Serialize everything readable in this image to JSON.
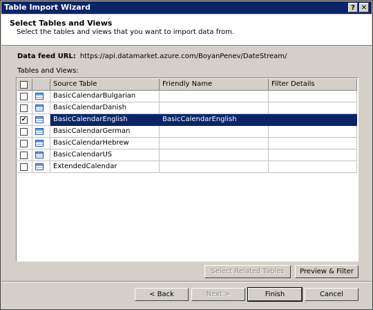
{
  "window": {
    "title": "Table Import Wizard",
    "help_glyph": "?",
    "close_glyph": "✕"
  },
  "header": {
    "title": "Select Tables and Views",
    "subtitle": "Select the tables and views that you want to import data from."
  },
  "datafeed": {
    "label": "Data feed URL:",
    "url": "https://api.datamarket.azure.com/BoyanPenev/DateStream/"
  },
  "tables_label": "Tables and Views:",
  "grid": {
    "columns": [
      "Source Table",
      "Friendly Name",
      "Filter Details"
    ],
    "rows": [
      {
        "checked": false,
        "source": "BasicCalendarBulgarian",
        "friendly": "",
        "filter": ""
      },
      {
        "checked": false,
        "source": "BasicCalendarDanish",
        "friendly": "",
        "filter": ""
      },
      {
        "checked": true,
        "source": "BasicCalendarEnglish",
        "friendly": "BasicCalendarEnglish",
        "filter": ""
      },
      {
        "checked": false,
        "source": "BasicCalendarGerman",
        "friendly": "",
        "filter": ""
      },
      {
        "checked": false,
        "source": "BasicCalendarHebrew",
        "friendly": "",
        "filter": ""
      },
      {
        "checked": false,
        "source": "BasicCalendarUS",
        "friendly": "",
        "filter": ""
      },
      {
        "checked": false,
        "source": "ExtendedCalendar",
        "friendly": "",
        "filter": ""
      }
    ]
  },
  "buttons": {
    "select_related": "Select Related Tables",
    "preview": "Preview & Filter",
    "back": "< Back",
    "next": "Next >",
    "finish": "Finish",
    "cancel": "Cancel"
  }
}
